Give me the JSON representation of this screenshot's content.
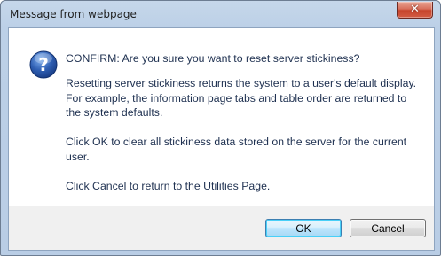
{
  "dialog": {
    "title": "Message from webpage",
    "close_glyph": "✕",
    "icon": "question-icon",
    "message": {
      "line1": "CONFIRM: Are you sure you want to reset server stickiness?",
      "para1": "Resetting server stickiness returns the system to a user's default display. For example, the information page tabs and table order are returned to the system defaults.",
      "para2": "Click OK to clear all stickiness data stored on the server for the current user.",
      "para3": "Click Cancel to return to the Utilities Page."
    },
    "buttons": {
      "ok_label": "OK",
      "cancel_label": "Cancel"
    }
  },
  "colors": {
    "frame": "#b9cde5",
    "close_button": "#c7442c",
    "icon_blue": "#2f5fb3",
    "footer": "#f0f0f0"
  }
}
